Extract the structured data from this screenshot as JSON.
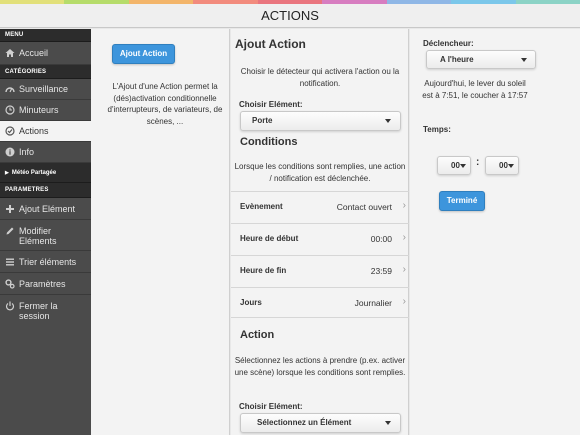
{
  "colors": {
    "rainbow": [
      "#e2e07a",
      "#b6dc6b",
      "#f3b56a",
      "#f28b7d",
      "#e9757e",
      "#d77dc0",
      "#8fb7e6",
      "#7bc7ea",
      "#8cd3c6"
    ],
    "accent": "#3d95dc",
    "sidebar_bg": "#4b4b4b",
    "sidebar_section_bg": "#2c2c2c"
  },
  "header": {
    "title": "ACTIONS"
  },
  "sidebar": {
    "menu_label": "MENU",
    "accueil": {
      "label": "Accueil",
      "icon": "home-icon"
    },
    "categories_label": "CATÉGORIES",
    "categories": [
      {
        "label": "Surveillance",
        "icon": "gauge-icon"
      },
      {
        "label": "Minuteurs",
        "icon": "clock-icon"
      },
      {
        "label": "Actions",
        "icon": "check-circle-icon",
        "active": true
      },
      {
        "label": "Info",
        "icon": "info-icon"
      }
    ],
    "meteo_label": "Météo Partagée",
    "parametres_label": "PARAMETRES",
    "parametres": [
      {
        "label": "Ajout Elément",
        "icon": "plus-icon"
      },
      {
        "label": "Modifier Eléments",
        "icon": "pencil-icon"
      },
      {
        "label": "Trier éléments",
        "icon": "sort-icon"
      },
      {
        "label": "Paramètres",
        "icon": "gears-icon"
      },
      {
        "label": "Fermer la session",
        "icon": "power-icon"
      }
    ]
  },
  "left_panel": {
    "button_label": "Ajout Action",
    "description": "L'Ajout d'une Action permet la (dés)activation conditionnelle d'interrupteurs, de variateurs, de scènes, ..."
  },
  "main": {
    "title": "Ajout Action",
    "intro": "Choisir le détecteur qui activera l'action ou la notification.",
    "choose_label": "Choisir Elément:",
    "element_select": "Porte",
    "conditions_title": "Conditions",
    "conditions_desc": "Lorsque les conditions sont remplies, une action / notification est déclenchée.",
    "rows": [
      {
        "label": "Evènement",
        "value": "Contact ouvert"
      },
      {
        "label": "Heure de début",
        "value": "00:00"
      },
      {
        "label": "Heure de fin",
        "value": "23:59"
      },
      {
        "label": "Jours",
        "value": "Journalier"
      }
    ],
    "action_title": "Action",
    "action_desc": "Sélectionnez les actions à prendre (p.ex. activer une scène) lorsque les conditions sont remplies.",
    "action_choose_label": "Choisir Elément:",
    "action_select": "Sélectionnez un Élément"
  },
  "right_panel": {
    "trigger_label": "Déclencheur:",
    "trigger_select": "A l'heure",
    "sun_info": "Aujourd'hui, le lever du soleil est à 7:51, le coucher à 17:57",
    "time_label": "Temps:",
    "hours": "00",
    "minutes": "00",
    "colon": ":",
    "done_label": "Terminé"
  }
}
